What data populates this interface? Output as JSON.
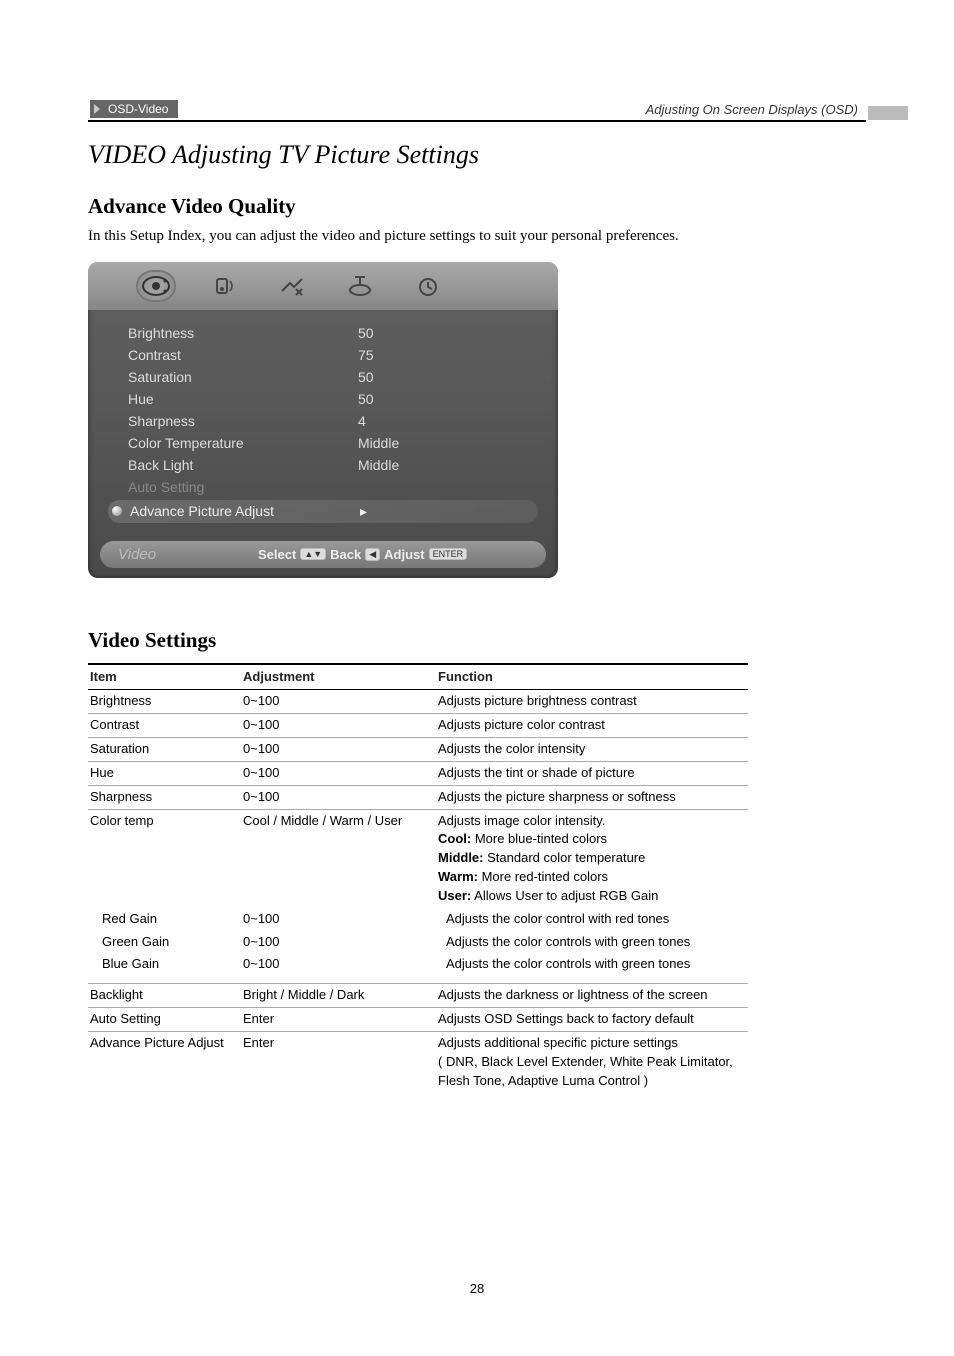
{
  "header": {
    "tag": "OSD-Video",
    "right": "Adjusting On Screen Displays (OSD)"
  },
  "title": "VIDEO Adjusting TV Picture Settings",
  "advance": {
    "heading": "Advance Video Quality",
    "desc": "In this Setup Index, you can adjust the video and picture settings to suit your personal preferences."
  },
  "osd": {
    "rows": [
      {
        "label": "Brightness",
        "value": "50"
      },
      {
        "label": "Contrast",
        "value": "75"
      },
      {
        "label": "Saturation",
        "value": "50"
      },
      {
        "label": "Hue",
        "value": "50"
      },
      {
        "label": "Sharpness",
        "value": "4"
      },
      {
        "label": "Color Temperature",
        "value": "Middle"
      },
      {
        "label": "Back Light",
        "value": "Middle"
      },
      {
        "label": "Auto Setting",
        "value": ""
      }
    ],
    "highlight": {
      "label": "Advance Picture Adjust",
      "value": "▸"
    },
    "footer_section": "Video",
    "footer_select": "Select",
    "footer_back": "Back",
    "footer_adjust": "Adjust",
    "kbd_arrows": "▲▼",
    "kbd_left": "◀",
    "kbd_enter": "ENTER"
  },
  "settings": {
    "heading": "Video Settings",
    "headers": {
      "c1": "Item",
      "c2": "Adjustment",
      "c3": "Function"
    },
    "rows": [
      {
        "item": "Brightness",
        "adj": "0~100",
        "fn": "Adjusts picture brightness contrast"
      },
      {
        "item": "Contrast",
        "adj": "0~100",
        "fn": "Adjusts picture color contrast"
      },
      {
        "item": "Saturation",
        "adj": "0~100",
        "fn": "Adjusts the color intensity"
      },
      {
        "item": "Hue",
        "adj": "0~100",
        "fn": "Adjusts the tint or shade of picture"
      },
      {
        "item": "Sharpness",
        "adj": "0~100",
        "fn": "Adjusts the picture sharpness or softness"
      }
    ],
    "colortemp": {
      "item": "Color temp",
      "adj": "Cool / Middle / Warm / User",
      "fn_main": "Adjusts image color intensity.",
      "opts": [
        {
          "b": "Cool:",
          "t": " More blue-tinted colors"
        },
        {
          "b": "Middle:",
          "t": " Standard color temperature"
        },
        {
          "b": "Warm:",
          "t": " More red-tinted colors"
        },
        {
          "b": "User:",
          "t": " Allows User to adjust RGB Gain"
        }
      ]
    },
    "gains": [
      {
        "item": "Red Gain",
        "adj": "0~100",
        "fn": "Adjusts the color control with red tones"
      },
      {
        "item": "Green Gain",
        "adj": "0~100",
        "fn": "Adjusts the color controls with green tones"
      },
      {
        "item": "Blue Gain",
        "adj": "0~100",
        "fn": "Adjusts the color controls with green tones"
      }
    ],
    "backlight": {
      "item": "Backlight",
      "adj": "Bright / Middle / Dark",
      "fn": "Adjusts the darkness or lightness of the screen"
    },
    "autosetting": {
      "item": "Auto Setting",
      "adj": "Enter",
      "fn": "Adjusts OSD Settings back to factory default"
    },
    "advance": {
      "item": "Advance Picture Adjust",
      "adj": "Enter",
      "fn1": "Adjusts additional specific picture settings",
      "fn2": "( DNR, Black Level Extender, White Peak Limitator,",
      "fn3": "Flesh Tone, Adaptive Luma Control )"
    }
  },
  "page_number": "28"
}
